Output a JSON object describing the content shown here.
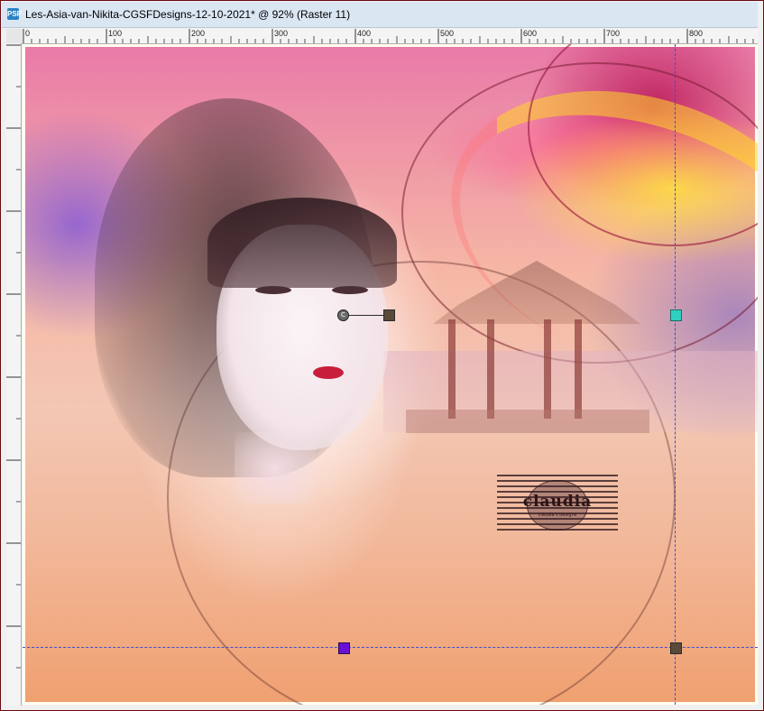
{
  "window": {
    "title": "Les-Asia-van-Nikita-CGSFDesigns-12-10-2021* @  92% (Raster 11)",
    "app_icon": "PSP"
  },
  "ruler": {
    "horizontal_labels": [
      "0",
      "100",
      "200",
      "300",
      "400",
      "500",
      "600",
      "700",
      "800"
    ]
  },
  "canvas": {
    "watermark_text": "claudia",
    "watermark_subtext": "claudia's designs",
    "pivot_glyph": "C"
  },
  "colors": {
    "guide": "#3d4fd0",
    "handle_right": "#2fd0c0",
    "handle_bottom": "#6a0fd6",
    "handle_corner": "#5a4a3a"
  }
}
